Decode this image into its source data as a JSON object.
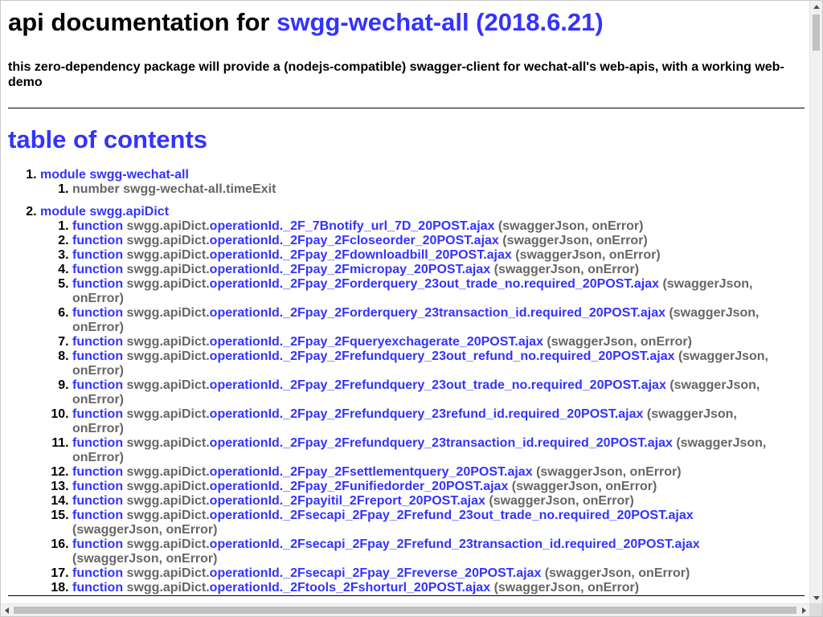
{
  "header": {
    "title_prefix": "api documentation for",
    "title_link": "swgg-wechat-all (2018.6.21)",
    "description": "this zero-dependency package will provide a (nodejs-compatible) swagger-client for wechat-all's web-apis, with a working web-demo"
  },
  "toc": {
    "title": "table of contents",
    "modules": [
      {
        "keyword": "module",
        "name": "swgg-wechat-all",
        "items": [
          {
            "kind": "number",
            "prefix": "swgg-wechat-all.timeExit",
            "name": "",
            "args": ""
          }
        ]
      },
      {
        "keyword": "module",
        "name": "swgg.apiDict",
        "items": [
          {
            "kind": "function",
            "prefix": "swgg.apiDict.",
            "name": "operationId._2F_7Bnotify_url_7D_20POST.ajax",
            "args": "(swaggerJson, onError)"
          },
          {
            "kind": "function",
            "prefix": "swgg.apiDict.",
            "name": "operationId._2Fpay_2Fcloseorder_20POST.ajax",
            "args": "(swaggerJson, onError)"
          },
          {
            "kind": "function",
            "prefix": "swgg.apiDict.",
            "name": "operationId._2Fpay_2Fdownloadbill_20POST.ajax",
            "args": "(swaggerJson, onError)"
          },
          {
            "kind": "function",
            "prefix": "swgg.apiDict.",
            "name": "operationId._2Fpay_2Fmicropay_20POST.ajax",
            "args": "(swaggerJson, onError)"
          },
          {
            "kind": "function",
            "prefix": "swgg.apiDict.",
            "name": "operationId._2Fpay_2Forderquery_23out_trade_no.required_20POST.ajax",
            "args": "(swaggerJson, onError)"
          },
          {
            "kind": "function",
            "prefix": "swgg.apiDict.",
            "name": "operationId._2Fpay_2Forderquery_23transaction_id.required_20POST.ajax",
            "args": "(swaggerJson, onError)"
          },
          {
            "kind": "function",
            "prefix": "swgg.apiDict.",
            "name": "operationId._2Fpay_2Fqueryexchagerate_20POST.ajax",
            "args": "(swaggerJson, onError)"
          },
          {
            "kind": "function",
            "prefix": "swgg.apiDict.",
            "name": "operationId._2Fpay_2Frefundquery_23out_refund_no.required_20POST.ajax",
            "args": "(swaggerJson, onError)"
          },
          {
            "kind": "function",
            "prefix": "swgg.apiDict.",
            "name": "operationId._2Fpay_2Frefundquery_23out_trade_no.required_20POST.ajax",
            "args": "(swaggerJson, onError)"
          },
          {
            "kind": "function",
            "prefix": "swgg.apiDict.",
            "name": "operationId._2Fpay_2Frefundquery_23refund_id.required_20POST.ajax",
            "args": "(swaggerJson, onError)"
          },
          {
            "kind": "function",
            "prefix": "swgg.apiDict.",
            "name": "operationId._2Fpay_2Frefundquery_23transaction_id.required_20POST.ajax",
            "args": "(swaggerJson, onError)"
          },
          {
            "kind": "function",
            "prefix": "swgg.apiDict.",
            "name": "operationId._2Fpay_2Fsettlementquery_20POST.ajax",
            "args": "(swaggerJson, onError)"
          },
          {
            "kind": "function",
            "prefix": "swgg.apiDict.",
            "name": "operationId._2Fpay_2Funifiedorder_20POST.ajax",
            "args": "(swaggerJson, onError)"
          },
          {
            "kind": "function",
            "prefix": "swgg.apiDict.",
            "name": "operationId._2Fpayitil_2Freport_20POST.ajax",
            "args": "(swaggerJson, onError)"
          },
          {
            "kind": "function",
            "prefix": "swgg.apiDict.",
            "name": "operationId._2Fsecapi_2Fpay_2Frefund_23out_trade_no.required_20POST.ajax",
            "args": "(swaggerJson, onError)"
          },
          {
            "kind": "function",
            "prefix": "swgg.apiDict.",
            "name": "operationId._2Fsecapi_2Fpay_2Frefund_23transaction_id.required_20POST.ajax",
            "args": "(swaggerJson, onError)"
          },
          {
            "kind": "function",
            "prefix": "swgg.apiDict.",
            "name": "operationId._2Fsecapi_2Fpay_2Freverse_20POST.ajax",
            "args": "(swaggerJson, onError)"
          },
          {
            "kind": "function",
            "prefix": "swgg.apiDict.",
            "name": "operationId._2Ftools_2Fshorturl_20POST.ajax",
            "args": "(swaggerJson, onError)"
          }
        ]
      }
    ]
  },
  "colors": {
    "link": "#3333ff",
    "muted": "#666666",
    "text": "#000000"
  },
  "icons": {
    "scroll_up": "arrow-up-icon",
    "scroll_down": "arrow-down-icon",
    "scroll_left": "arrow-left-icon",
    "scroll_right": "arrow-right-icon"
  }
}
